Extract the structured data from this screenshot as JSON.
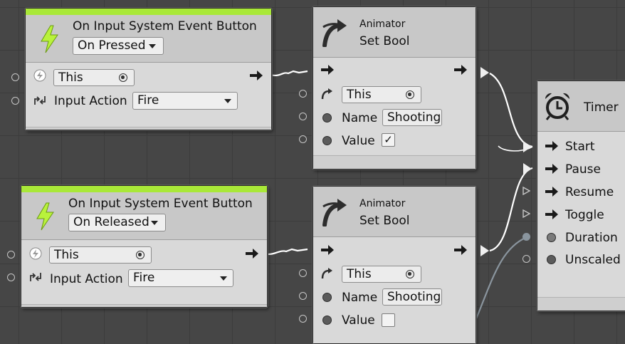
{
  "nodes": {
    "event1": {
      "title": "On Input System Event Button",
      "mode": "On Pressed",
      "target": "This",
      "input_action_label": "Input Action",
      "input_action_value": "Fire"
    },
    "event2": {
      "title": "On Input System Event Button",
      "mode": "On Released",
      "target": "This",
      "input_action_label": "Input Action",
      "input_action_value": "Fire"
    },
    "setbool1": {
      "category": "Animator",
      "title": "Set Bool",
      "target": "This",
      "name_label": "Name",
      "name_value": "Shooting",
      "value_label": "Value",
      "value_checked": "✓"
    },
    "setbool2": {
      "category": "Animator",
      "title": "Set Bool",
      "target": "This",
      "name_label": "Name",
      "name_value": "Shooting",
      "value_label": "Value",
      "value_checked": ""
    },
    "timer": {
      "title": "Timer",
      "ports": [
        "Start",
        "Pause",
        "Resume",
        "Toggle",
        "Duration",
        "Unscaled"
      ]
    }
  },
  "colors": {
    "graph_background": "#464646",
    "node_body": "#d9d9d9",
    "event_accent": "#a9e838",
    "flow_wire": "#ffffff",
    "value_wire": "#8a959e"
  },
  "icons": {
    "event": "lightning-icon",
    "animator": "curved-arrow-icon",
    "timer": "alarm-clock-icon",
    "input_action": "input-action-icon"
  }
}
